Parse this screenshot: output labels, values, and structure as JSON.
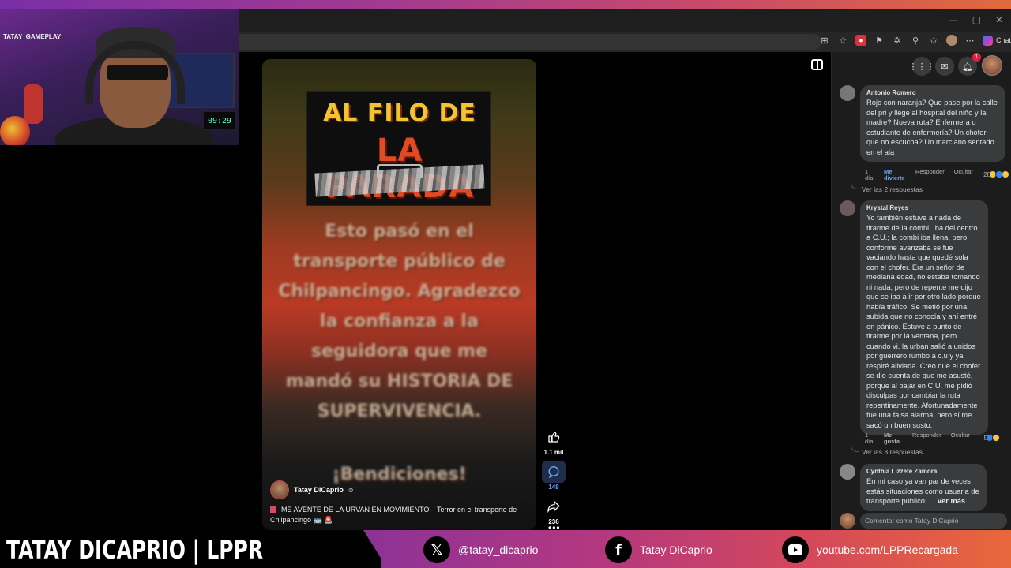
{
  "webcam": {
    "overlay_name": "TATAY_GAMEPLAY",
    "clock": "09:29"
  },
  "browser": {
    "chat_label": "Chat"
  },
  "video": {
    "poster_line1": "AL FILO DE",
    "poster_line2": "LA PARADA",
    "blurred_text": "Esto pasó en el transporte público de Chilpancingo. Agradezco la confianza a la seguidora que me mandó su HISTORIA DE SUPERVIVENCIA.",
    "blurred_footer": "¡Bendiciones!",
    "author": "Tatay DiCaprio",
    "title": "¡ME AVENTÉ DE LA URVAN EN MOVIMIENTO! | Terror en el transporte de Chilpancingo 🚌 🚨",
    "likes": "1.1 mil",
    "comments": "148",
    "shares": "236"
  },
  "header": {
    "notification_count": "1"
  },
  "comments": [
    {
      "author": "Antonio Romero",
      "text": "Rojo con naranja? Que pase por la calle del pri y llege al hospital del niño y la madre? Nueva ruta? Enfermera o estudiante de enfermería? Un chofer que no escucha? Un marciano sentado en el ala",
      "time": "1 día",
      "reaction_label": "Me divierte",
      "reply": "Responder",
      "hide": "Ocultar",
      "reaction_count": "28",
      "replies": "Ver las 2 respuestas"
    },
    {
      "author": "Krystal Reyes",
      "text": "Yo también estuve a nada de tirarme de la combi. Iba del centro a C.U.; la combi iba llena, pero conforme avanzaba se fue vaciando hasta que quedé sola con el chofer. Era un señor de mediana edad, no estaba tomando ni nada, pero de repente me dijo que se iba a ir por otro lado porque había tráfico. Se metió por una subida que no conocía y ahí entré en pánico. Estuve a punto de tirarme por la ventana, pero cuando vi, la urban salió a unidos por guerrero rumbo a c.u y ya respiré aliviada. Creo que el chofer se dio cuenta de que me asusté, porque al bajar en C.U. me pidió disculpas por cambiar la ruta repentinamente. Afortunadamente fue una falsa alarma, pero sí me sacó un buen susto.",
      "time": "1 día",
      "reaction_label": "Me gusta",
      "reply": "Responder",
      "hide": "Ocultar",
      "reaction_count": "5",
      "replies": "Ver las 3 respuestas"
    },
    {
      "author": "Cynthia Lizzete Zamora",
      "text": "En mi caso ya van par de veces estás situaciones como usuaria de transporte público: ...",
      "more": "Ver más"
    }
  ],
  "reply_placeholder": "Comentar como Tatay DiCaprio",
  "banner": {
    "name": "TATAY DICAPRIO | LPPR",
    "twitter": "@tatay_dicaprio",
    "facebook": "Tatay DiCaprio",
    "youtube": "youtube.com/LPPRecargada"
  },
  "colors": {
    "accent_blue": "#6aa8ff",
    "facebook_panel": "#1c1c1c",
    "bubble": "#3a3b3c"
  }
}
